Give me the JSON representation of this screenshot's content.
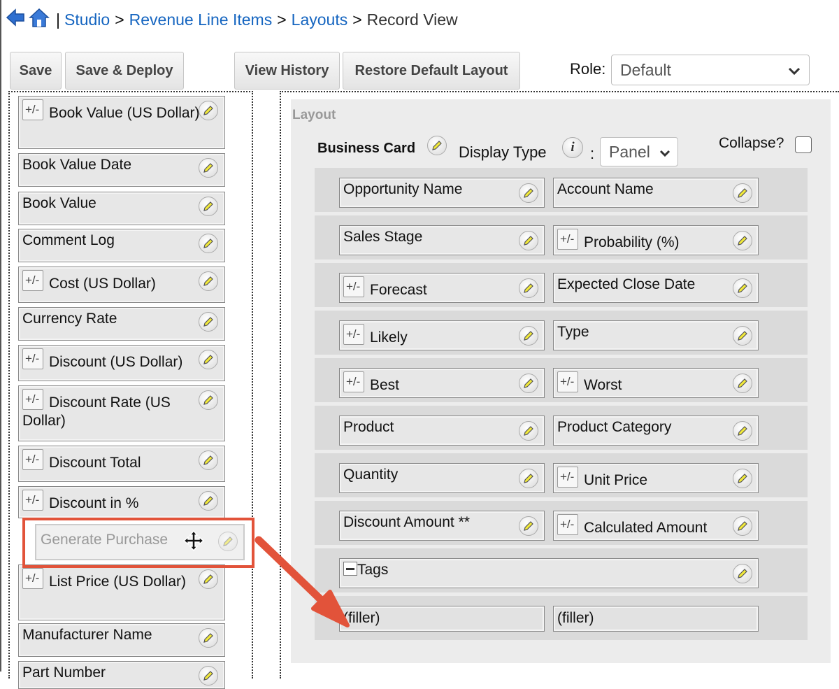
{
  "breadcrumb": {
    "items": [
      "Studio",
      "Revenue Line Items",
      "Layouts"
    ],
    "separator": ">",
    "current": "Record View",
    "pipe": "|"
  },
  "toolbar": {
    "save": "Save",
    "save_deploy": "Save & Deploy",
    "view_history": "View History",
    "restore_default": "Restore Default Layout",
    "role_label": "Role:",
    "role_value": "Default"
  },
  "toolbox": {
    "fields": [
      {
        "label": "Book Value (US Dollar)",
        "calculated": true
      },
      {
        "label": "Book Value Date",
        "calculated": false
      },
      {
        "label": "Book Value",
        "calculated": false
      },
      {
        "label": "Comment Log",
        "calculated": false
      },
      {
        "label": "Cost (US Dollar)",
        "calculated": true
      },
      {
        "label": "Currency Rate",
        "calculated": false
      },
      {
        "label": "Discount (US Dollar)",
        "calculated": true
      },
      {
        "label": "Discount Rate (US Dollar)",
        "calculated": true
      },
      {
        "label": "Discount Total",
        "calculated": true
      },
      {
        "label": "Discount in %",
        "calculated": true
      },
      {
        "label": "List Price (US Dollar)",
        "calculated": true
      },
      {
        "label": "Manufacturer Name",
        "calculated": false
      },
      {
        "label": "Part Number",
        "calculated": false
      }
    ],
    "dragging": "Generate Purchase"
  },
  "layout": {
    "title": "Layout",
    "panel_name": "Business Card",
    "display_type_label": "Display Type",
    "colon": ":",
    "panel_select": "Panel",
    "collapse_label": "Collapse?",
    "info_glyph": "i",
    "calc_glyph": "+/-",
    "tags_glyph": "—",
    "rows": [
      [
        {
          "label": "Opportunity Name",
          "calculated": false
        },
        {
          "label": "Account Name",
          "calculated": false
        }
      ],
      [
        {
          "label": "Sales Stage",
          "calculated": false
        },
        {
          "label": "Probability (%)",
          "calculated": true
        }
      ],
      [
        {
          "label": "Forecast",
          "calculated": true
        },
        {
          "label": "Expected Close Date",
          "calculated": false
        }
      ],
      [
        {
          "label": "Likely",
          "calculated": true
        },
        {
          "label": "Type",
          "calculated": false
        }
      ],
      [
        {
          "label": "Best",
          "calculated": true
        },
        {
          "label": "Worst",
          "calculated": true
        }
      ],
      [
        {
          "label": "Product",
          "calculated": false
        },
        {
          "label": "Product Category",
          "calculated": false
        }
      ],
      [
        {
          "label": "Quantity",
          "calculated": false
        },
        {
          "label": "Unit Price",
          "calculated": true
        }
      ],
      [
        {
          "label": "Discount Amount **",
          "calculated": false
        },
        {
          "label": "Calculated Amount",
          "calculated": true
        }
      ]
    ],
    "tags_row": "Tags",
    "filler": [
      "(filler)",
      "(filler)"
    ]
  },
  "colors": {
    "link": "#1565c0",
    "highlight": "#e2533a",
    "pencil_fill": "#f2ea3a"
  }
}
